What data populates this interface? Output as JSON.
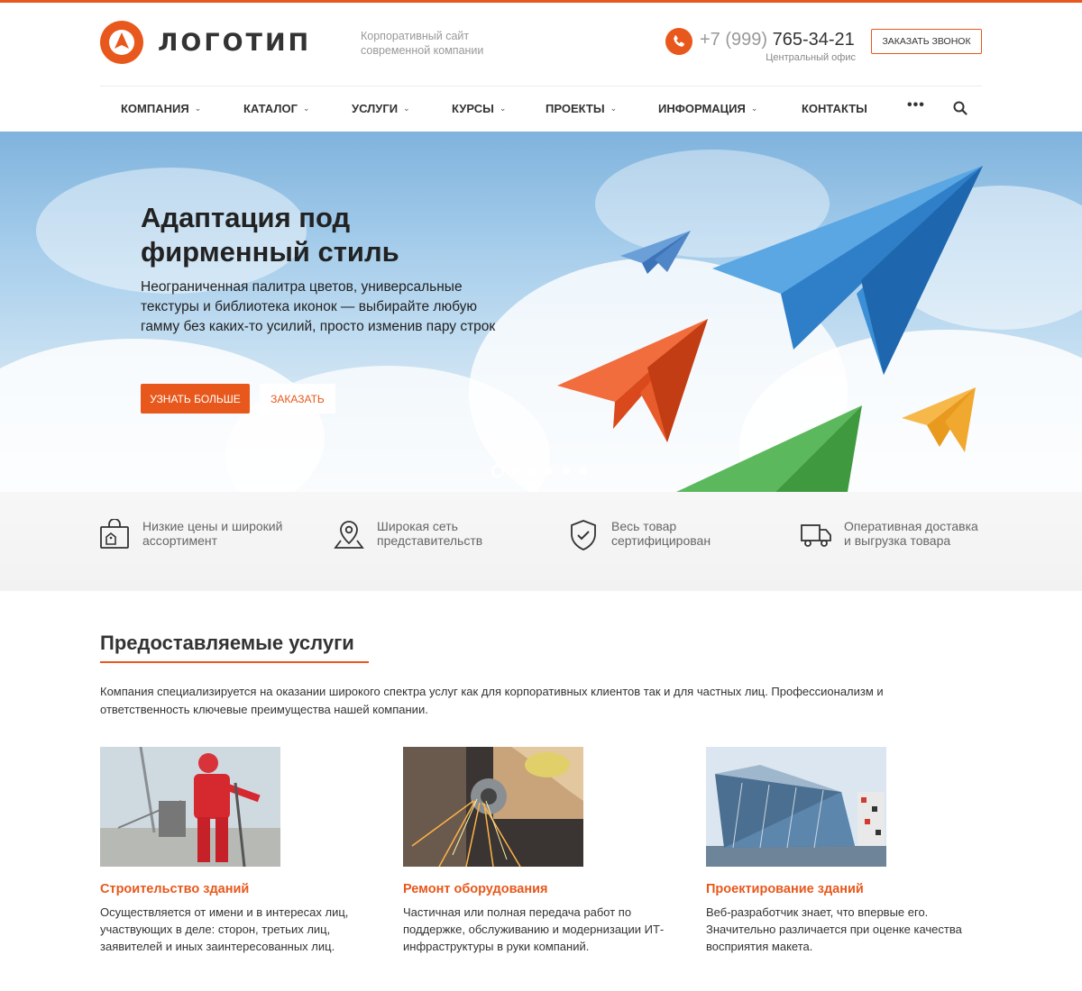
{
  "header": {
    "logo_text": "ЛОГОТИП",
    "tagline_line1": "Корпоративный сайт",
    "tagline_line2": "современной компании",
    "phone_prefix": "+7 (999)",
    "phone_main": "765-34-21",
    "phone_note": "Центральный офис",
    "callback_label": "ЗАКАЗАТЬ ЗВОНОК"
  },
  "nav": {
    "items": [
      {
        "label": "КОМПАНИЯ",
        "dropdown": true
      },
      {
        "label": "КАТАЛОГ",
        "dropdown": true
      },
      {
        "label": "УСЛУГИ",
        "dropdown": true
      },
      {
        "label": "КУРСЫ",
        "dropdown": true
      },
      {
        "label": "ПРОЕКТЫ",
        "dropdown": true
      },
      {
        "label": "ИНФОРМАЦИЯ",
        "dropdown": true
      },
      {
        "label": "КОНТАКТЫ",
        "dropdown": false
      }
    ],
    "more_label": "•••",
    "search_icon": "search-icon"
  },
  "hero": {
    "title_line1": "Адаптация под",
    "title_line2": "фирменный стиль",
    "text": "Неограниченная палитра цветов, универсальные текстуры и библиотека иконок — выбирайте любую гамму без каких-то усилий, просто изменив пару строк",
    "primary_button": "УЗНАТЬ БОЛЬШЕ",
    "secondary_button": "ЗАКАЗАТЬ",
    "slides_total": 6,
    "active_slide": 1
  },
  "features": [
    {
      "icon": "shopping-bag-icon",
      "line1": "Низкие цены и широкий",
      "line2": "ассортимент"
    },
    {
      "icon": "map-pin-icon",
      "line1": "Широкая сеть",
      "line2": "представительств"
    },
    {
      "icon": "shield-check-icon",
      "line1": "Весь товар",
      "line2": "сертифицирован"
    },
    {
      "icon": "truck-icon",
      "line1": "Оперативная доставка",
      "line2": "и выгрузка товара"
    }
  ],
  "services": {
    "title": "Предоставляемые услуги",
    "intro": "Компания специализируется на оказании широкого спектра услуг как для корпоративных клиентов так и для частных лиц. Профессионализм и ответственность ключевые преимущества нашей компании.",
    "cards": [
      {
        "title": "Строительство зданий",
        "text": "Осуществляется от имени и в интересах лиц, участвующих в деле: сторон, третьих лиц, заявителей и иных заинтересованных лиц."
      },
      {
        "title": "Ремонт оборудования",
        "text": "Частичная или полная передача работ по поддержке, обслуживанию и модернизации ИТ-инфраструктуры в руки компаний."
      },
      {
        "title": "Проектирование зданий",
        "text": "Веб-разработчик знает, что впервые его. Значительно различается при оценке качества восприятия макета."
      }
    ]
  },
  "colors": {
    "accent": "#e8581c",
    "text": "#333333",
    "muted": "#999999"
  }
}
